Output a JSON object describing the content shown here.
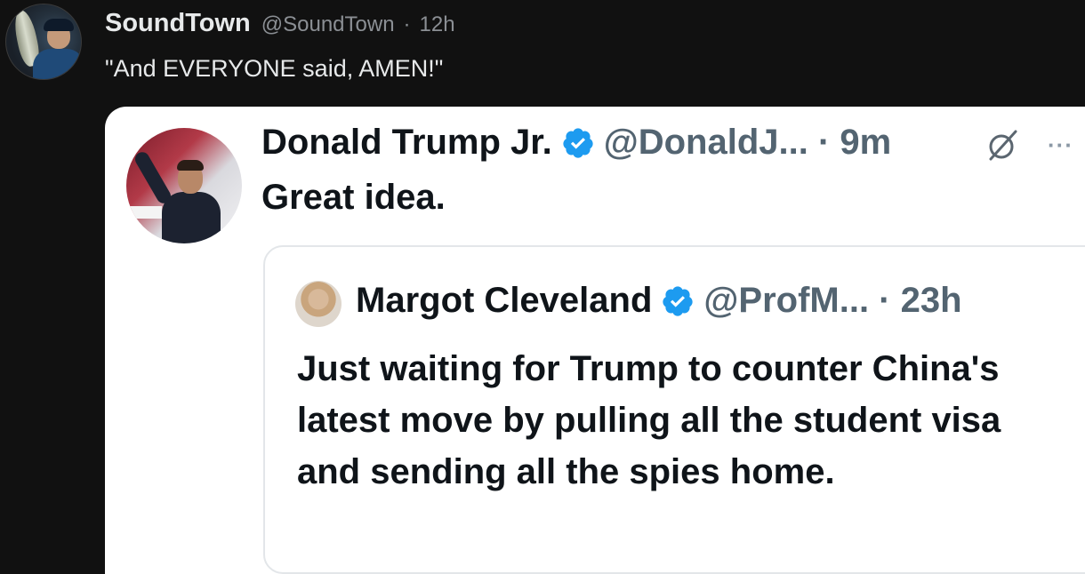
{
  "post": {
    "display_name": "SoundTown",
    "handle": "@SoundTown",
    "separator": "·",
    "time": "12h",
    "text": "\"And EVERYONE said, AMEN!\""
  },
  "embedded_screenshot": {
    "author": {
      "display_name": "Donald Trump Jr.",
      "handle_time": "@DonaldJ... · 9m",
      "verified": true,
      "text": "Great idea."
    },
    "quoted": {
      "display_name": "Margot Cleveland",
      "handle_time": "@ProfM... · 23h",
      "verified": true,
      "text": "Just waiting for Trump to counter China's latest move by pulling all the student visa and sending all the spies home."
    },
    "more_glyph": "···"
  },
  "colors": {
    "background": "#111111",
    "verified_badge": "#1d9bf0",
    "primary_text_dark": "#e7e9ea",
    "secondary_text": "#8b8f94"
  }
}
